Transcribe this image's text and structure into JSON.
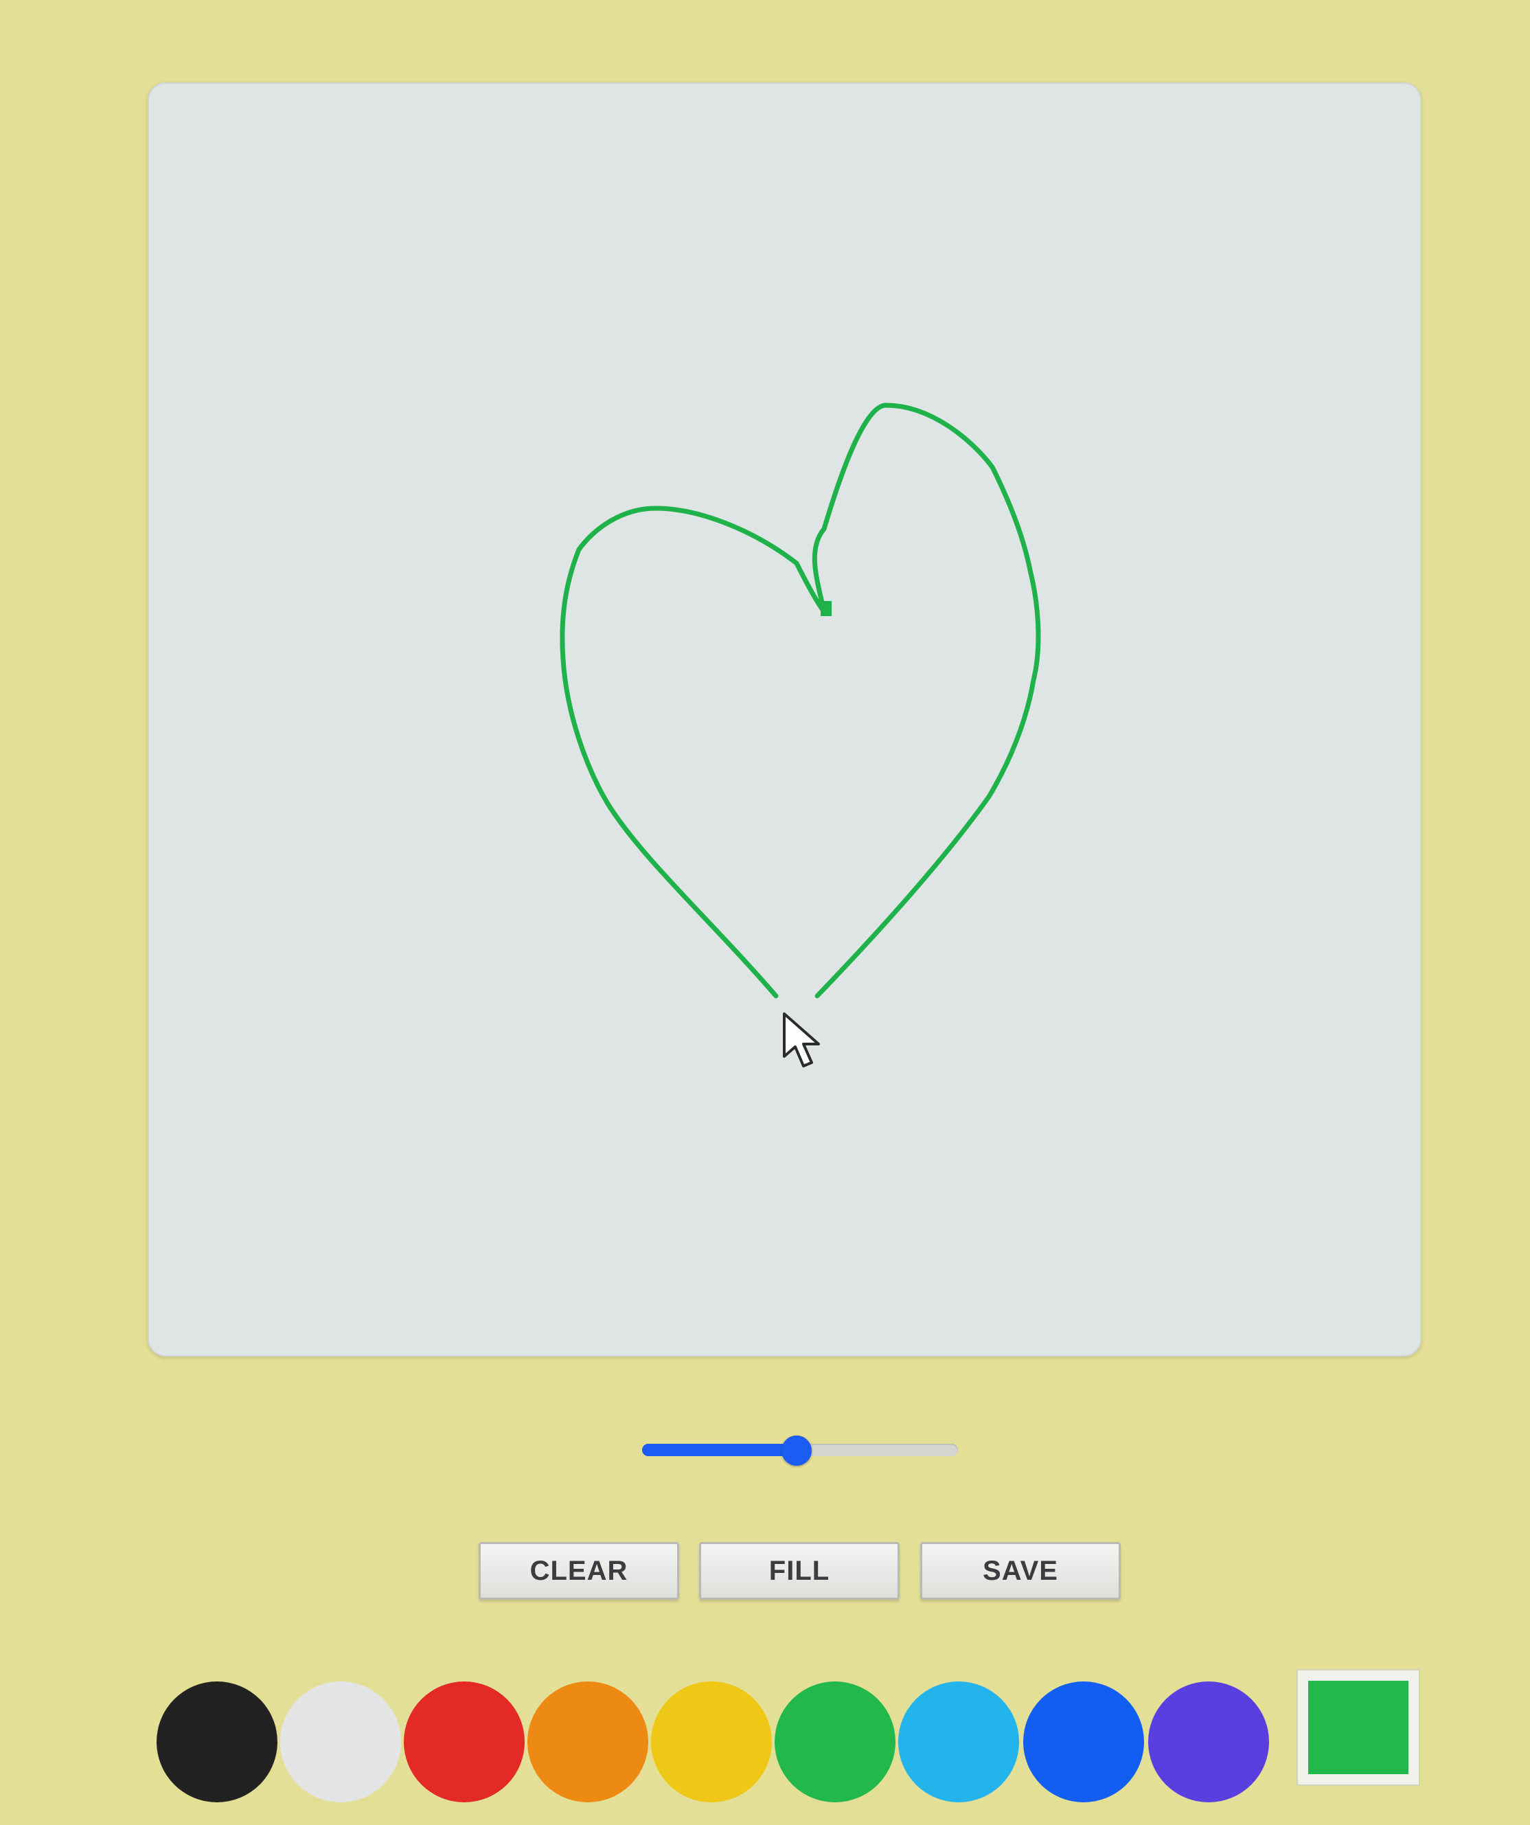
{
  "drawing": {
    "stroke_color": "#1fb24a",
    "shape": "heart outline"
  },
  "brush_size_slider": {
    "value": 0.49
  },
  "buttons": {
    "clear_label": "CLEAR",
    "fill_label": "FILL",
    "save_label": "SAVE"
  },
  "palette": [
    {
      "name": "black",
      "color": "#222222"
    },
    {
      "name": "white",
      "color": "#e3e4e6"
    },
    {
      "name": "red",
      "color": "#e32a27"
    },
    {
      "name": "orange",
      "color": "#ec8a14"
    },
    {
      "name": "yellow",
      "color": "#efc716"
    },
    {
      "name": "green",
      "color": "#22b84b"
    },
    {
      "name": "light-blue",
      "color": "#22b4ea"
    },
    {
      "name": "blue",
      "color": "#125ef2"
    },
    {
      "name": "purple",
      "color": "#5a3fe0"
    }
  ],
  "current_color": {
    "color": "#22b84b"
  }
}
